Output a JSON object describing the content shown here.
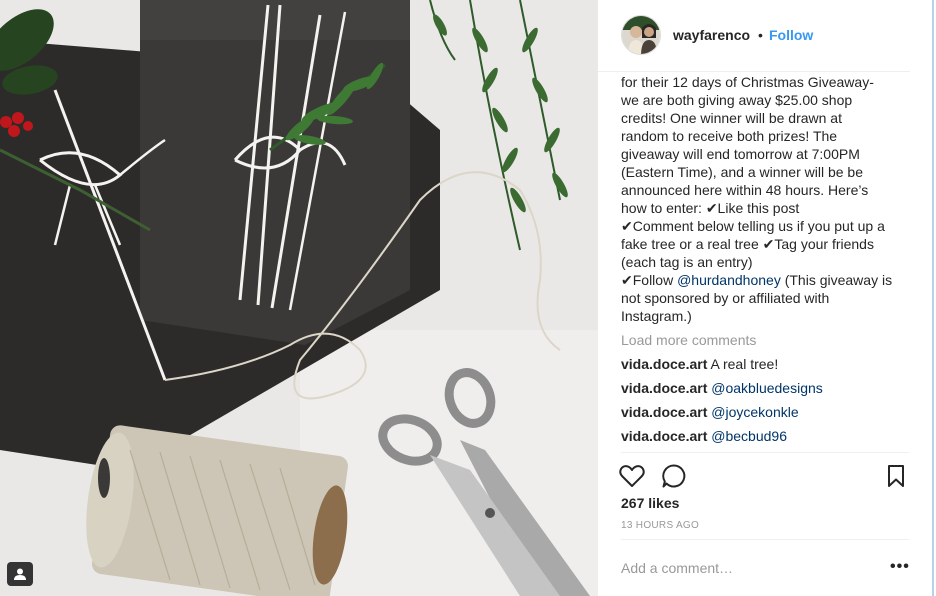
{
  "post": {
    "username": "wayfarenco",
    "separator": "•",
    "follow_label": "Follow"
  },
  "caption": {
    "lines": [
      "for their 12 days of Christmas Giveaway-",
      "we are both giving away $25.00 shop",
      "credits! One winner will be drawn at",
      "random to receive both prizes! The",
      "giveaway will end tomorrow at 7:00PM",
      "(Eastern Time), and a winner will be be",
      "announced here within 48 hours. Here’s",
      "how to enter: ✔Like this post",
      "✔Comment below telling us if you put up a",
      "fake tree or a real tree ✔Tag your friends",
      "(each tag is an entry)"
    ],
    "last_prefix": "✔Follow ",
    "mention": "@hurdandhoney",
    "last_suffix": " (This giveaway is",
    "tail_lines": [
      "not sponsored by or affiliated with",
      "Instagram.)"
    ]
  },
  "load_more": "Load more comments",
  "comments": [
    {
      "user": "vida.doce.art",
      "text": "A real tree!",
      "is_mention": false
    },
    {
      "user": "vida.doce.art",
      "text": "@oakbluedesigns",
      "is_mention": true
    },
    {
      "user": "vida.doce.art",
      "text": "@joycekonkle",
      "is_mention": true
    },
    {
      "user": "vida.doce.art",
      "text": "@becbud96",
      "is_mention": true
    }
  ],
  "likes": "267 likes",
  "time": "13 HOURS AGO",
  "add_comment_placeholder": "Add a comment…",
  "more_options": "•••",
  "icons": {
    "like": "heart-icon",
    "comment": "speech-bubble-icon",
    "save": "bookmark-icon",
    "tagged": "user-tag-icon"
  },
  "colors": {
    "link": "#3897f0",
    "mention": "#003569",
    "muted": "#999999",
    "text": "#262626"
  }
}
